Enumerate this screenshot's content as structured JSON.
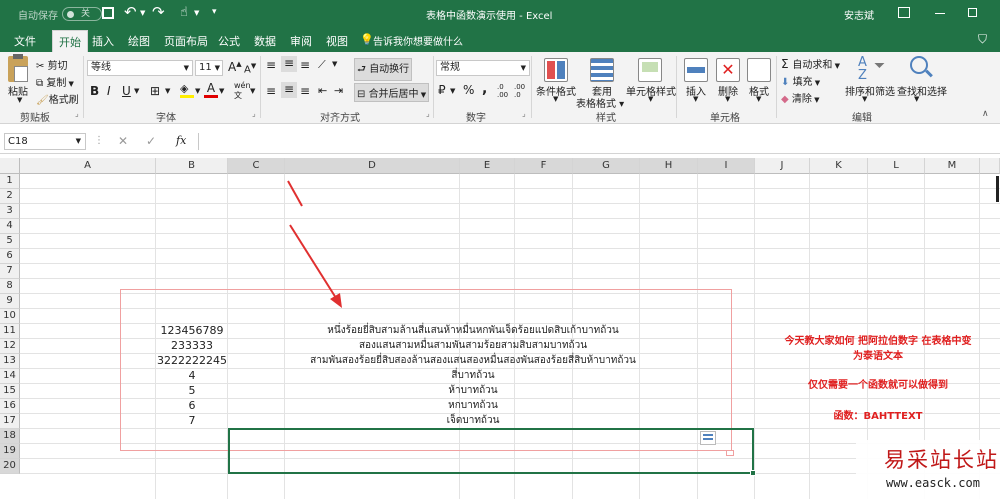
{
  "titlebar": {
    "autosave": "自动保存",
    "autosave_state": "关",
    "title": "表格中函数演示使用  -  Excel",
    "user": "安志斌"
  },
  "tabs": [
    "文件",
    "开始",
    "插入",
    "绘图",
    "页面布局",
    "公式",
    "数据",
    "审阅",
    "视图"
  ],
  "tell_me": "告诉我你想要做什么",
  "ribbon": {
    "clipboard": {
      "paste": "粘贴",
      "cut": "剪切",
      "copy": "复制",
      "format_painter": "格式刷",
      "label": "剪贴板"
    },
    "font": {
      "name": "等线",
      "size": "11",
      "grow": "A",
      "shrink": "A",
      "bold": "B",
      "italic": "I",
      "underline": "U",
      "wen": "wén",
      "label": "字体"
    },
    "alignment": {
      "wrap": "自动换行",
      "merge": "合并后居中",
      "label": "对齐方式"
    },
    "number": {
      "format": "常规",
      "percent": "%",
      "comma": ",",
      "inc": ".0 .00",
      "dec": ".00 .0",
      "label": "数字"
    },
    "styles": {
      "conditional": "条件格式",
      "table": "套用\n表格格式",
      "cell": "单元格样式",
      "label": "样式"
    },
    "cells": {
      "insert": "插入",
      "delete": "删除",
      "format": "格式",
      "label": "单元格"
    },
    "editing": {
      "autosum": "自动求和",
      "fill": "填充",
      "clear": "清除",
      "sort": "排序和筛选",
      "find": "查找和选择",
      "label": "编辑"
    }
  },
  "formula_bar": {
    "name_box": "C18",
    "fx": "fx",
    "value": ""
  },
  "columns": [
    "A",
    "B",
    "C",
    "D",
    "E",
    "F",
    "G",
    "H",
    "I",
    "J",
    "K",
    "L",
    "M"
  ],
  "rows": [
    "1",
    "2",
    "3",
    "4",
    "5",
    "6",
    "7",
    "8",
    "9",
    "10",
    "11",
    "12",
    "13",
    "14",
    "15",
    "16",
    "17",
    "18",
    "19",
    "20"
  ],
  "data": [
    {
      "row": 11,
      "b": "123456789",
      "d": "หนึ่งร้อยยี่สิบสามล้านสี่แสนห้าหมื่นหกพันเจ็ดร้อยแปดสิบเก้าบาทถ้วน"
    },
    {
      "row": 12,
      "b": "233333",
      "d": "สองแสนสามหมื่นสามพันสามร้อยสามสิบสามบาทถ้วน"
    },
    {
      "row": 13,
      "b": "3222222245",
      "d": "สามพันสองร้อยยี่สิบสองล้านสองแสนสองหมื่นสองพันสองร้อยสี่สิบห้าบาทถ้วน"
    },
    {
      "row": 14,
      "b": "4",
      "d": "สี่บาทถ้วน"
    },
    {
      "row": 15,
      "b": "5",
      "d": "ห้าบาทถ้วน"
    },
    {
      "row": 16,
      "b": "6",
      "d": "หกบาทถ้วน"
    },
    {
      "row": 17,
      "b": "7",
      "d": "เจ็ดบาทถ้วน"
    }
  ],
  "notes": {
    "line1": "今天教大家如何 把阿拉伯数字 在表格中变",
    "line2": "为泰语文本",
    "line3": "仅仅需要一个函数就可以做得到",
    "line4": "函数：BAHTTEXT"
  },
  "watermark": {
    "cn": "易采站长站",
    "url": "www.easck.com"
  },
  "colors": {
    "excel_green": "#217346",
    "annot_red": "#e02020"
  }
}
